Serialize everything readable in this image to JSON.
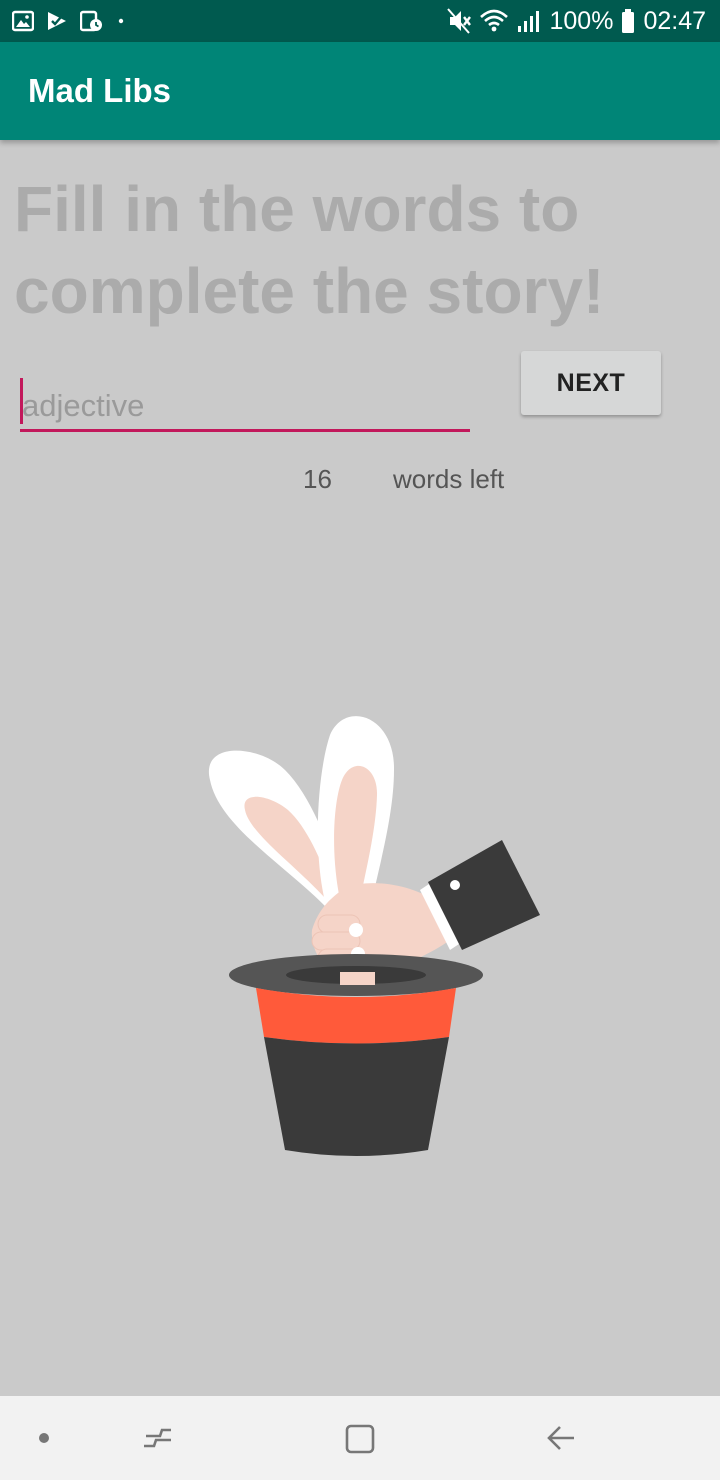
{
  "status_bar": {
    "icons_left": [
      "gallery-icon",
      "check-flag-icon",
      "calendar-clock-icon",
      "dot-icon"
    ],
    "icons_right": [
      "mute-icon",
      "wifi-icon",
      "signal-icon"
    ],
    "battery": "100%",
    "time": "02:47",
    "background": "#005a4f"
  },
  "app_bar": {
    "title": "Mad Libs",
    "color": "#008577"
  },
  "main": {
    "headline": "Fill in the words to complete the story!",
    "word_input": {
      "value": "",
      "placeholder": "adjective",
      "accent": "#c2185b"
    },
    "next_label": "NEXT",
    "words_left_count": "16",
    "words_left_label": "words left",
    "illustration": "magic-hat-rabbit"
  },
  "nav_bar": {
    "buttons": [
      "dot-icon",
      "recent-apps-icon",
      "home-icon",
      "back-icon"
    ]
  }
}
